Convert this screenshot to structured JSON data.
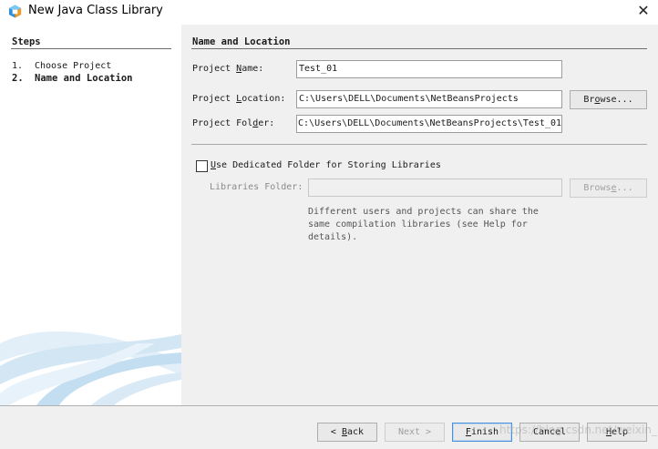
{
  "window": {
    "title": "New Java Class Library",
    "close_glyph": "✕"
  },
  "steps": {
    "heading": "Steps",
    "items": [
      {
        "number": "1.",
        "label": "Choose Project"
      },
      {
        "number": "2.",
        "label": "Name and Location"
      }
    ]
  },
  "main": {
    "heading": "Name and Location",
    "project_name": {
      "label_pre": "Project ",
      "label_mn": "N",
      "label_post": "ame:",
      "value": "Test_01"
    },
    "project_location": {
      "label_pre": "Project ",
      "label_mn": "L",
      "label_post": "ocation:",
      "value": "C:\\Users\\DELL\\Documents\\NetBeansProjects"
    },
    "project_folder": {
      "label_pre": "Project Fol",
      "label_mn": "d",
      "label_post": "er:",
      "value": "C:\\Users\\DELL\\Documents\\NetBeansProjects\\Test_01"
    },
    "browse": {
      "pre": "Br",
      "mn": "o",
      "post": "wse..."
    },
    "dedicated": {
      "mn": "U",
      "post": "se Dedicated Folder for Storing Libraries",
      "checked": false
    },
    "libraries_folder": {
      "label": "Libraries Folder:",
      "value": ""
    },
    "browse2": {
      "pre": "Brows",
      "mn": "e",
      "post": "..."
    },
    "hint": "Different users and projects can share the same compilation libraries (see Help for details)."
  },
  "buttons": {
    "back": {
      "arrow": "< ",
      "mn": "B",
      "post": "ack"
    },
    "next": {
      "label": "Next >"
    },
    "finish": {
      "mn": "F",
      "post": "inish"
    },
    "cancel": {
      "label": "Cancel"
    },
    "help": {
      "mn": "H",
      "post": "elp"
    }
  },
  "watermark": "https://blog.csdn.net/weixin_DELL",
  "colors": {
    "accent": "#4a90d9",
    "panel": "#f0f0f0",
    "swoosh": "#d6e8f5"
  }
}
